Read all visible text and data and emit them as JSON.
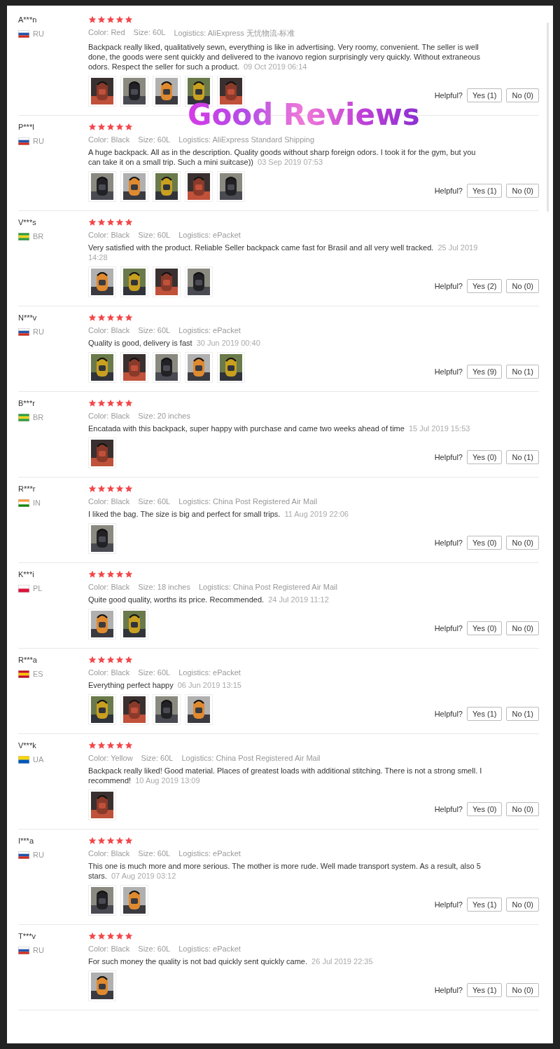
{
  "overlay_title": "Good Reviews",
  "reviews": [
    {
      "name": "A***n",
      "country": "RU",
      "flag": [
        {
          "color": "#ffffff"
        },
        {
          "color": "#2255aa"
        },
        {
          "color": "#d52b1e"
        }
      ],
      "stars": 5,
      "meta": [
        "Color: Red",
        "Size: 60L",
        "Logistics: AliExpress 无忧物流-标准"
      ],
      "text": "Backpack really liked, qualitatively sewn, everything is like in advertising. Very roomy, convenient. The seller is well done, the goods were sent quickly and delivered to the ivanovo region surprisingly very quickly. Without extraneous odors. Respect the seller for such a product.",
      "date": "09 Oct 2019 06:14",
      "photos": [
        {
          "kind": "picture"
        },
        {
          "kind": "picture"
        },
        {
          "kind": "picture"
        },
        {
          "kind": "picture"
        },
        {
          "kind": "picture"
        }
      ],
      "helpful_label": "Helpful?",
      "yes": "Yes (1)",
      "no": "No (0)"
    },
    {
      "name": "P***l",
      "country": "RU",
      "flag": [
        {
          "color": "#ffffff"
        },
        {
          "color": "#2255aa"
        },
        {
          "color": "#d52b1e"
        }
      ],
      "stars": 5,
      "meta": [
        "Color: Black",
        "Size: 60L",
        "Logistics: AliExpress Standard Shipping"
      ],
      "text": "A huge backpack. All as in the description. Quality goods without sharp foreign odors. I took it for the gym, but you can take it on a small trip. Such a mini suitcase))",
      "date": "03 Sep 2019 07:53",
      "photos": [
        {
          "kind": "picture"
        },
        {
          "kind": "picture"
        },
        {
          "kind": "picture"
        },
        {
          "kind": "picture"
        },
        {
          "kind": "picture"
        }
      ],
      "helpful_label": "Helpful?",
      "yes": "Yes (1)",
      "no": "No (0)"
    },
    {
      "name": "V***s",
      "country": "BR",
      "flag": [
        {
          "color": "#2a9d3a"
        },
        {
          "color": "#f2d21b"
        },
        {
          "color": "#2a9d3a"
        }
      ],
      "stars": 5,
      "meta": [
        "Color: Black",
        "Size: 60L",
        "Logistics: ePacket"
      ],
      "text": "Very satisfied with the product. Reliable Seller backpack came fast for Brasil and all very well tracked.",
      "date": "25 Jul 2019 14:28",
      "photos": [
        {
          "kind": "picture"
        },
        {
          "kind": "picture"
        },
        {
          "kind": "picture"
        },
        {
          "kind": "picture"
        }
      ],
      "helpful_label": "Helpful?",
      "yes": "Yes (2)",
      "no": "No (0)"
    },
    {
      "name": "N***v",
      "country": "RU",
      "flag": [
        {
          "color": "#ffffff"
        },
        {
          "color": "#2255aa"
        },
        {
          "color": "#d52b1e"
        }
      ],
      "stars": 5,
      "meta": [
        "Color: Black",
        "Size: 60L",
        "Logistics: ePacket"
      ],
      "text": "Quality is good, delivery is fast",
      "date": "30 Jun 2019 00:40",
      "photos": [
        {
          "kind": "picture"
        },
        {
          "kind": "picture"
        },
        {
          "kind": "picture"
        },
        {
          "kind": "picture"
        },
        {
          "kind": "picture"
        }
      ],
      "helpful_label": "Helpful?",
      "yes": "Yes (9)",
      "no": "No (1)"
    },
    {
      "name": "B***r",
      "country": "BR",
      "flag": [
        {
          "color": "#2a9d3a"
        },
        {
          "color": "#f2d21b"
        },
        {
          "color": "#2a9d3a"
        }
      ],
      "stars": 5,
      "meta": [
        "Color: Black",
        "Size: 20 inches"
      ],
      "text": "Encatada with this backpack, super happy with purchase and came two weeks ahead of time",
      "date": "15 Jul 2019 15:53",
      "photos": [
        {
          "kind": "picture"
        }
      ],
      "helpful_label": "Helpful?",
      "yes": "Yes (0)",
      "no": "No (1)"
    },
    {
      "name": "R***r",
      "country": "IN",
      "flag": [
        {
          "color": "#ff9933"
        },
        {
          "color": "#ffffff"
        },
        {
          "color": "#138808"
        }
      ],
      "stars": 5,
      "meta": [
        "Color: Black",
        "Size: 60L",
        "Logistics: China Post Registered Air Mail"
      ],
      "text": "I liked the bag. The size is big and perfect for small trips.",
      "date": "11 Aug 2019 22:06",
      "photos": [
        {
          "kind": "picture"
        }
      ],
      "helpful_label": "Helpful?",
      "yes": "Yes (0)",
      "no": "No (0)"
    },
    {
      "name": "K***i",
      "country": "PL",
      "flag": [
        {
          "color": "#ffffff"
        },
        {
          "color": "#dc143c"
        }
      ],
      "stars": 5,
      "meta": [
        "Color: Black",
        "Size: 18 inches",
        "Logistics: China Post Registered Air Mail"
      ],
      "text": "Quite good quality, worths its price. Recommended.",
      "date": "24 Jul 2019 11:12",
      "photos": [
        {
          "kind": "picture"
        },
        {
          "kind": "picture"
        }
      ],
      "helpful_label": "Helpful?",
      "yes": "Yes (0)",
      "no": "No (0)"
    },
    {
      "name": "R***a",
      "country": "ES",
      "flag": [
        {
          "color": "#c60b1e"
        },
        {
          "color": "#ffc400"
        },
        {
          "color": "#c60b1e"
        }
      ],
      "stars": 5,
      "meta": [
        "Color: Black",
        "Size: 60L",
        "Logistics: ePacket"
      ],
      "text": "Everything perfect happy",
      "date": "06 Jun 2019 13:15",
      "photos": [
        {
          "kind": "picture"
        },
        {
          "kind": "picture"
        },
        {
          "kind": "picture"
        },
        {
          "kind": "picture"
        }
      ],
      "helpful_label": "Helpful?",
      "yes": "Yes (1)",
      "no": "No (1)"
    },
    {
      "name": "V***k",
      "country": "UA",
      "flag": [
        {
          "color": "#ffd700"
        },
        {
          "color": "#0057b7"
        }
      ],
      "stars": 5,
      "meta": [
        "Color: Yellow",
        "Size: 60L",
        "Logistics: China Post Registered Air Mail"
      ],
      "text": "Backpack really liked! Good material. Places of greatest loads with additional stitching. There is not a strong smell. I recommend!",
      "date": "10 Aug 2019 13:09",
      "photos": [
        {
          "kind": "picture"
        }
      ],
      "helpful_label": "Helpful?",
      "yes": "Yes (0)",
      "no": "No (0)"
    },
    {
      "name": "I***a",
      "country": "RU",
      "flag": [
        {
          "color": "#ffffff"
        },
        {
          "color": "#2255aa"
        },
        {
          "color": "#d52b1e"
        }
      ],
      "stars": 5,
      "meta": [
        "Color: Black",
        "Size: 60L",
        "Logistics: ePacket"
      ],
      "text": "This one is much more and more serious. The mother is more rude. Well made transport system. As a result, also 5 stars.",
      "date": "07 Aug 2019 03:12",
      "photos": [
        {
          "kind": "picture"
        },
        {
          "kind": "picture"
        }
      ],
      "helpful_label": "Helpful?",
      "yes": "Yes (1)",
      "no": "No (0)"
    },
    {
      "name": "T***v",
      "country": "RU",
      "flag": [
        {
          "color": "#ffffff"
        },
        {
          "color": "#2255aa"
        },
        {
          "color": "#d52b1e"
        }
      ],
      "stars": 5,
      "meta": [
        "Color: Black",
        "Size: 60L",
        "Logistics: ePacket"
      ],
      "text": "For such money the quality is not bad quickly sent quickly came.",
      "date": "26 Jul 2019 22:35",
      "photos": [
        {
          "kind": "picture"
        }
      ],
      "helpful_label": "Helpful?",
      "yes": "Yes (1)",
      "no": "No (0)"
    }
  ]
}
